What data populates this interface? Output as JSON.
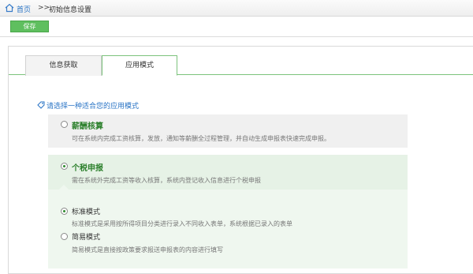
{
  "breadcrumb": {
    "home": "首页",
    "separator": ">>",
    "current": "初始信息设置"
  },
  "toolbar": {
    "save_label": "保存"
  },
  "tabs": [
    {
      "label": "信息获取",
      "active": false
    },
    {
      "label": "应用模式",
      "active": true
    }
  ],
  "prompt": "请选择一种适合您的应用模式",
  "options": {
    "salary": {
      "title": "薪酬核算",
      "selected": false,
      "description": "可在系统内完成工资核算，发放，通知等薪酬全过程管理，并自动生成申报表快速完成申报。"
    },
    "tax": {
      "title": "个税申报",
      "selected": true,
      "description": "需在系统外完成工资等收入核算，系统内登记收入信息进行个税申报",
      "submodes": {
        "standard": {
          "title": "标准模式",
          "selected": true,
          "description": "标准模式是采用按所得项目分类进行录入不同收入表单，系统根据已录入的表单"
        },
        "simple": {
          "title": "简易模式",
          "selected": false,
          "description": "简易模式是直接按政策要求报送申报表的内容进行填写"
        }
      }
    }
  },
  "colors": {
    "accent_green": "#5fbf5f",
    "link_blue": "#2a74c5",
    "title_green": "#2a7f2a"
  }
}
